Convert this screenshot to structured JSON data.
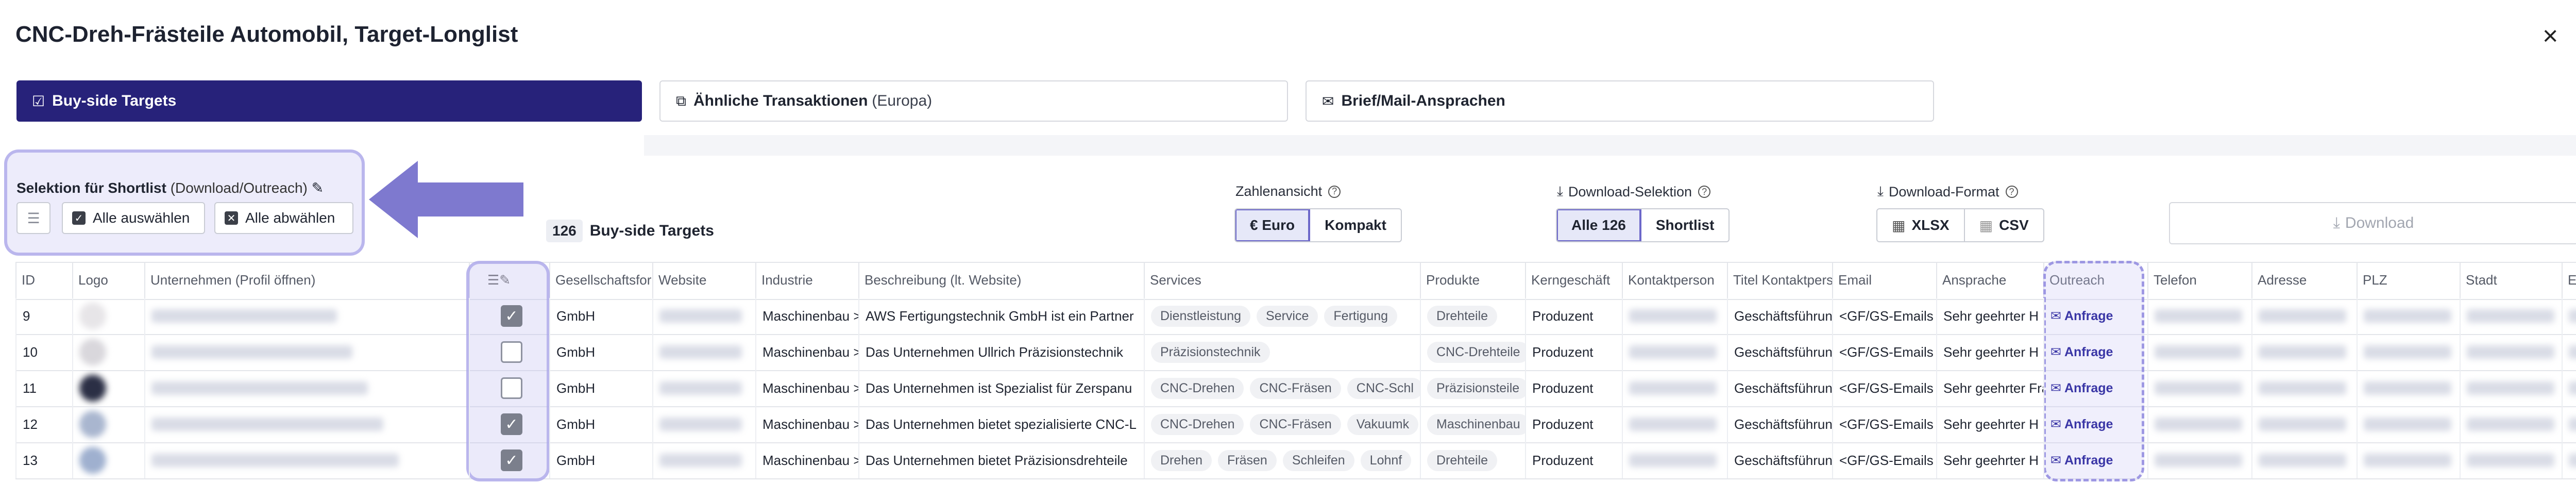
{
  "window": {
    "title": "CNC-Dreh-Frästeile Automobil, Target-Longlist",
    "close_icon": "×"
  },
  "tabs": [
    {
      "label": "Buy-side Targets",
      "icon": "list-check-icon",
      "active": true
    },
    {
      "label": "Ähnliche Transaktionen",
      "suffix": "(Europa)",
      "icon": "copy-icon",
      "active": false
    },
    {
      "label": "Brief/Mail-Ansprachen",
      "icon": "mail-icon",
      "active": false
    }
  ],
  "selection": {
    "title": "Selektion für Shortlist",
    "title_suffix": "(Download/Outreach)",
    "select_all": "Alle auswählen",
    "deselect_all": "Alle abwählen"
  },
  "list": {
    "count": "126",
    "label": "Buy-side Targets"
  },
  "zahlenansicht": {
    "label": "Zahlenansicht",
    "options": [
      "€ Euro",
      "Kompakt"
    ],
    "selected": "€ Euro"
  },
  "download_selektion": {
    "label": "Download-Selektion",
    "options": [
      "Alle 126",
      "Shortlist"
    ],
    "selected": "Alle 126"
  },
  "download_format": {
    "label": "Download-Format",
    "options": [
      "XLSX",
      "CSV"
    ]
  },
  "download_button": "Download",
  "columns": [
    "ID",
    "Logo",
    "Unternehmen (Profil öffnen)",
    "",
    "Gesellschaftsform",
    "Website",
    "Industrie",
    "Beschreibung (lt. Website)",
    "Services",
    "Produkte",
    "Kerngeschäft",
    "Kontaktperson",
    "Titel Kontaktperson",
    "Email",
    "Ansprache",
    "Outreach",
    "Telefon",
    "Adresse",
    "PLZ",
    "Stadt",
    "E"
  ],
  "rows": [
    {
      "id": "9",
      "checked": true,
      "form": "GmbH",
      "industrie": "Maschinenbau >",
      "beschreibung": "AWS Fertigungstechnik GmbH ist ein Partner",
      "services": [
        "Dienstleistung",
        "Service",
        "Fertigung"
      ],
      "produkte": "Drehteile",
      "kern": "Produzent",
      "titel": "Geschäftsführung",
      "email": "<GF/GS-Emails a",
      "ansprache": "Sehr geehrter H",
      "outreach": "Anfrage"
    },
    {
      "id": "10",
      "checked": false,
      "form": "GmbH",
      "industrie": "Maschinenbau >",
      "beschreibung": "Das Unternehmen Ullrich Präzisionstechnik",
      "services": [
        "Präzisionstechnik"
      ],
      "produkte": "CNC-Drehteile",
      "kern": "Produzent",
      "titel": "Geschäftsführung",
      "email": "<GF/GS-Emails a",
      "ansprache": "Sehr geehrter H",
      "outreach": "Anfrage"
    },
    {
      "id": "11",
      "checked": false,
      "form": "GmbH",
      "industrie": "Maschinenbau >",
      "beschreibung": "Das Unternehmen ist Spezialist für Zerspanu",
      "services": [
        "CNC-Drehen",
        "CNC-Fräsen",
        "CNC-Schl"
      ],
      "produkte": "Präzisionsteile",
      "kern": "Produzent",
      "titel": "Geschäftsführung",
      "email": "<GF/GS-Emails a",
      "ansprache": "Sehr geehrter Fra",
      "outreach": "Anfrage"
    },
    {
      "id": "12",
      "checked": true,
      "form": "GmbH",
      "industrie": "Maschinenbau >",
      "beschreibung": "Das Unternehmen bietet spezialisierte CNC-L",
      "services": [
        "CNC-Drehen",
        "CNC-Fräsen",
        "Vakuumk"
      ],
      "produkte": "Maschinenbau",
      "kern": "Produzent",
      "titel": "Geschäftsführung",
      "email": "<GF/GS-Emails a",
      "ansprache": "Sehr geehrter H",
      "outreach": "Anfrage"
    },
    {
      "id": "13",
      "checked": true,
      "form": "GmbH",
      "industrie": "Maschinenbau >",
      "beschreibung": "Das Unternehmen bietet Präzisionsdrehteile",
      "services": [
        "Drehen",
        "Fräsen",
        "Schleifen",
        "Lohnf"
      ],
      "produkte": "Drehteile",
      "kern": "Produzent",
      "titel": "Geschäftsführung",
      "email": "<GF/GS-Emails a",
      "ansprache": "Sehr geehrter H",
      "outreach": "Anfrage"
    }
  ]
}
